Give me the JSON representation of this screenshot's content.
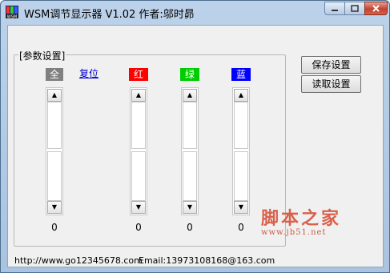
{
  "window": {
    "title": "WSM调节显示器 V1.02   作者:邬时昴"
  },
  "group": {
    "label": "[参数设置]"
  },
  "channels": [
    {
      "label": "全",
      "value": "0",
      "color": "#808080"
    },
    {
      "label": "红",
      "value": "0",
      "color": "#ff0000"
    },
    {
      "label": "绿",
      "value": "0",
      "color": "#00cc00"
    },
    {
      "label": "蓝",
      "value": "0",
      "color": "#0000ff"
    }
  ],
  "reset_link": "复位",
  "buttons": {
    "save": "保存设置",
    "load": "读取设置"
  },
  "status": {
    "url": "http://www.go12345678.com",
    "email": "Email:13973108168@163.com"
  },
  "watermark": {
    "title": "脚本之家",
    "url": "www.jb51.net"
  }
}
